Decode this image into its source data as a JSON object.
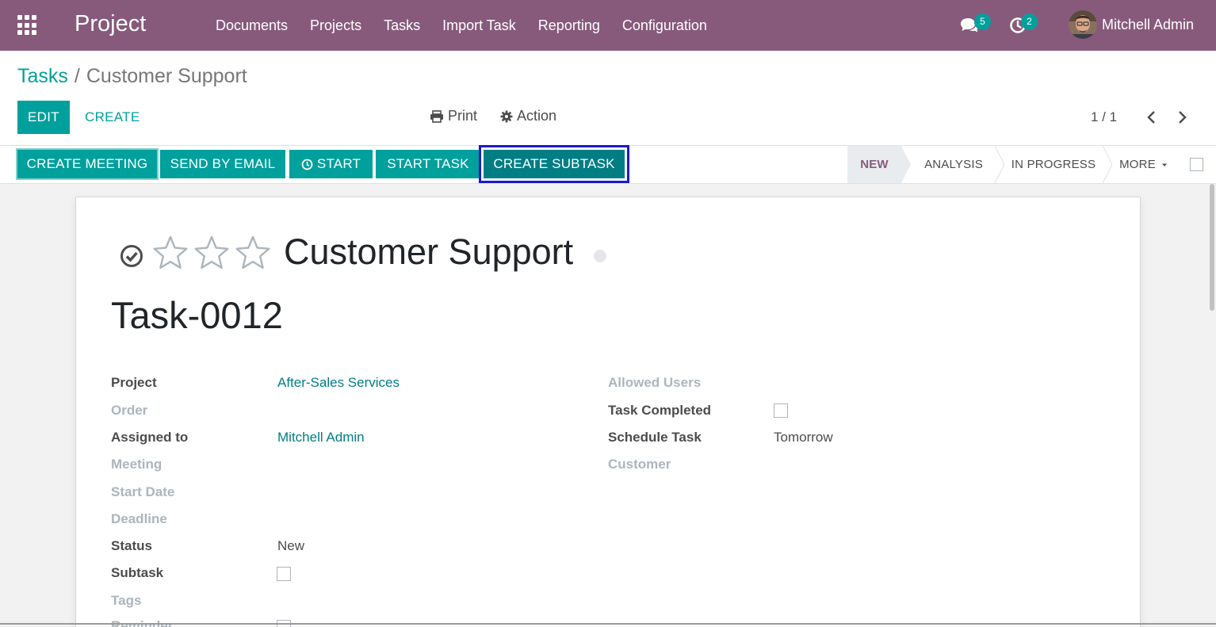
{
  "navbar": {
    "app_title": "Project",
    "menu": [
      "Documents",
      "Projects",
      "Tasks",
      "Import Task",
      "Reporting",
      "Configuration"
    ],
    "messages_count": "5",
    "activities_count": "2",
    "user_name": "Mitchell Admin",
    "icons": {
      "apps": "apps-grid-icon",
      "messages": "chat-icon",
      "activities": "clock-icon"
    }
  },
  "breadcrumb": {
    "parent": "Tasks",
    "separator": "/",
    "current": "Customer Support"
  },
  "control_panel": {
    "edit_label": "EDIT",
    "create_label": "CREATE",
    "print_label": "Print",
    "action_label": "Action",
    "pager": "1 / 1"
  },
  "statusbar": {
    "buttons": [
      "CREATE MEETING",
      "SEND BY EMAIL",
      "START",
      "START TASK",
      "CREATE SUBTASK"
    ],
    "stages": [
      "NEW",
      "ANALYSIS",
      "IN PROGRESS",
      "MORE"
    ],
    "active_stage": "NEW"
  },
  "task": {
    "name": "Customer Support",
    "reference": "Task-0012",
    "priority_stars": 3,
    "priority_value": 0
  },
  "fields_left": [
    {
      "label": "Project",
      "value": "After-Sales Services",
      "type": "link",
      "required": true
    },
    {
      "label": "Order",
      "value": "",
      "type": "text",
      "required": false
    },
    {
      "label": "Assigned to",
      "value": "Mitchell Admin",
      "type": "link",
      "required": true
    },
    {
      "label": "Meeting",
      "value": "",
      "type": "text",
      "required": false
    },
    {
      "label": "Start Date",
      "value": "",
      "type": "text",
      "required": false
    },
    {
      "label": "Deadline",
      "value": "",
      "type": "text",
      "required": false
    },
    {
      "label": "Status",
      "value": "New",
      "type": "text",
      "required": true
    },
    {
      "label": "Subtask",
      "value": false,
      "type": "checkbox",
      "required": true
    },
    {
      "label": "Tags",
      "value": "",
      "type": "text",
      "required": false
    },
    {
      "label": "Reminder",
      "value": false,
      "type": "checkbox",
      "required": false
    }
  ],
  "fields_right": [
    {
      "label": "Allowed Users",
      "value": "",
      "type": "text",
      "required": false
    },
    {
      "label": "Task Completed",
      "value": false,
      "type": "checkbox",
      "required": true
    },
    {
      "label": "Schedule Task",
      "value": "Tomorrow",
      "type": "text",
      "required": true
    },
    {
      "label": "Customer",
      "value": "",
      "type": "text",
      "required": false
    }
  ],
  "colors": {
    "brand": "#875a7b",
    "accent": "#00a09d",
    "link": "#017e84",
    "highlight_outline": "#1a1acc"
  }
}
